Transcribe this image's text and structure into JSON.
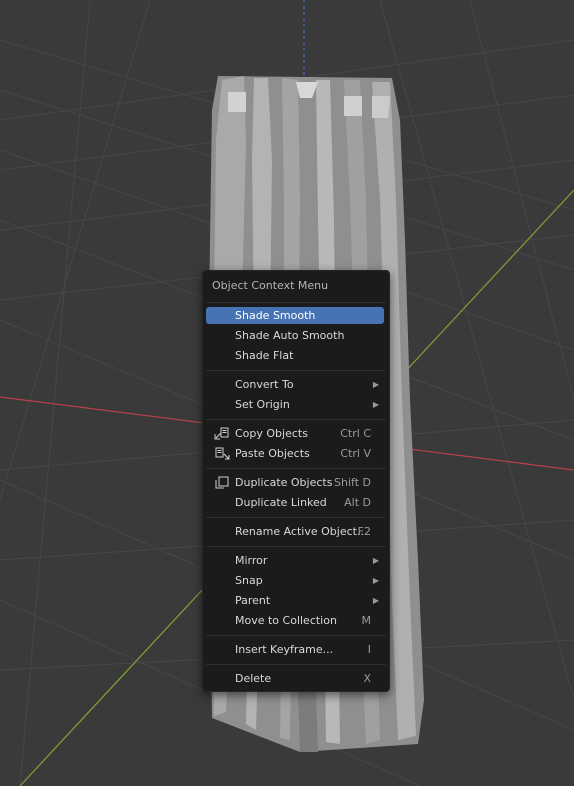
{
  "menu": {
    "title": "Object Context Menu",
    "shade_smooth": "Shade Smooth",
    "shade_auto_smooth": "Shade Auto Smooth",
    "shade_flat": "Shade Flat",
    "convert_to": "Convert To",
    "set_origin": "Set Origin",
    "copy_objects": "Copy Objects",
    "copy_objects_shortcut": "Ctrl C",
    "paste_objects": "Paste Objects",
    "paste_objects_shortcut": "Ctrl V",
    "duplicate_objects": "Duplicate Objects",
    "duplicate_objects_shortcut": "Shift D",
    "duplicate_linked": "Duplicate Linked",
    "duplicate_linked_shortcut": "Alt D",
    "rename_active_object": "Rename Active Object...",
    "rename_shortcut": "F2",
    "mirror": "Mirror",
    "snap": "Snap",
    "parent": "Parent",
    "move_to_collection": "Move to Collection",
    "move_to_collection_shortcut": "M",
    "insert_keyframe": "Insert Keyframe...",
    "insert_keyframe_shortcut": "I",
    "delete": "Delete",
    "delete_shortcut": "X",
    "submenu_arrow": "▶"
  },
  "colors": {
    "highlight": "#4772b3",
    "menu_bg": "#1b1b1b",
    "x_axis": "#b8404a",
    "y_axis": "#7ea332"
  }
}
